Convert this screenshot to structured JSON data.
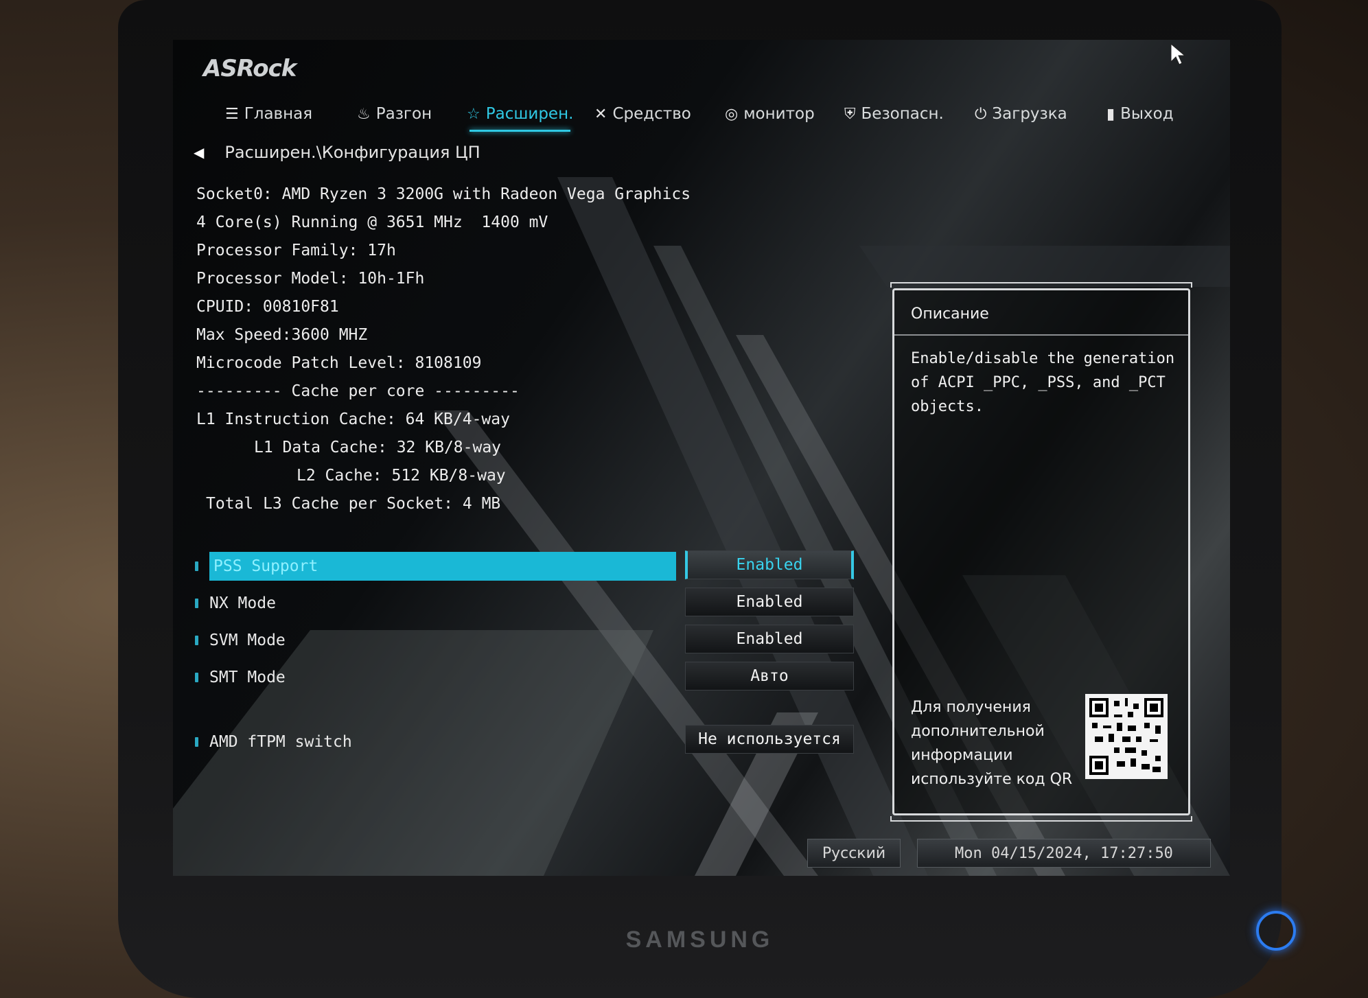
{
  "monitor": {
    "brand": "SAMSUNG"
  },
  "bios": {
    "logo": "ASRock",
    "nav": [
      {
        "label": "Главная",
        "icon": "list-icon"
      },
      {
        "label": "Разгон",
        "icon": "flame-icon"
      },
      {
        "label": "Расширен.",
        "icon": "star-icon",
        "active": true
      },
      {
        "label": "Средство",
        "icon": "tools-icon"
      },
      {
        "label": "монитор",
        "icon": "monitor-gauge-icon"
      },
      {
        "label": "Безопасн.",
        "icon": "shield-icon"
      },
      {
        "label": "Загрузка",
        "icon": "power-icon"
      },
      {
        "label": "Выход",
        "icon": "exit-icon"
      }
    ],
    "breadcrumb": "Расширен.\\Конфигурация ЦП",
    "cpu_info": {
      "socket": "Socket0: AMD Ryzen 3 3200G with Radeon Vega Graphics",
      "cores": "4 Core(s) Running @ 3651 MHz  1400 mV",
      "family": "Processor Family: 17h",
      "model": "Processor Model: 10h-1Fh",
      "cpuid": "CPUID: 00810F81",
      "max_speed": "Max Speed:3600 MHZ",
      "microcode": "Microcode Patch Level: 8108109",
      "cache_header": "--------- Cache per core ---------",
      "l1i": "L1 Instruction Cache: 64 KB/4-way",
      "l1d": "L1 Data Cache: 32 KB/8-way",
      "l2": "L2 Cache: 512 KB/8-way",
      "l3": "Total L3 Cache per Socket: 4 MB"
    },
    "options": [
      {
        "label": "PSS Support",
        "value": "Enabled",
        "selected": true
      },
      {
        "label": "NX Mode",
        "value": "Enabled"
      },
      {
        "label": "SVM Mode",
        "value": "Enabled"
      },
      {
        "label": "SMT Mode",
        "value": "Авто"
      },
      {
        "label": "AMD fTPM switch",
        "value": "Не используется"
      }
    ],
    "description": {
      "title": "Описание",
      "text": "Enable/disable the generation of ACPI _PPC, _PSS, and _PCT objects.",
      "qr_hint": "Для получения дополнительной информации используйте код QR"
    },
    "footer": {
      "language": "Русский",
      "datetime": "Mon 04/15/2024, 17:27:50"
    },
    "colors": {
      "accent": "#30c9e4",
      "selected_row": "#1ab8d6"
    }
  }
}
